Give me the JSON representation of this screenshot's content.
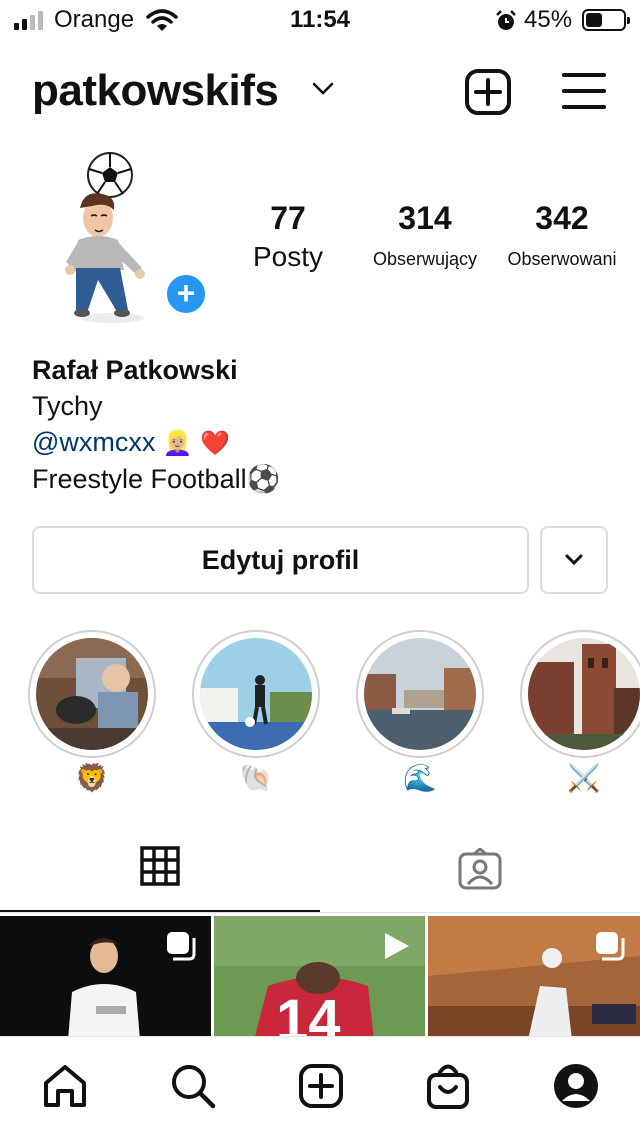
{
  "status": {
    "carrier": "Orange",
    "time": "11:54",
    "battery_percent": "45%",
    "battery_level": 0.45,
    "icons": [
      "signal-icon",
      "wifi-icon",
      "alarm-icon",
      "battery-icon"
    ]
  },
  "header": {
    "username": "patkowskifs",
    "icons": [
      "chevron-down-icon",
      "new-post-icon",
      "menu-icon"
    ]
  },
  "stats": [
    {
      "value": "77",
      "label": "Posty"
    },
    {
      "value": "314",
      "label": "Obserwujący"
    },
    {
      "value": "342",
      "label": "Obserwowani"
    }
  ],
  "bio": {
    "name": "Rafał Patkowski",
    "city": "Tychy",
    "mention": "@wxmcxx",
    "mention_emoji": "👱🏼‍♀️ ❤️",
    "description": "Freestyle Football⚽"
  },
  "actions": {
    "edit_profile": "Edytuj profil"
  },
  "highlights": [
    {
      "emoji": "🦁"
    },
    {
      "emoji": "🐚"
    },
    {
      "emoji": "🌊"
    },
    {
      "emoji": "⚔️"
    }
  ],
  "tabs": [
    "grid-icon",
    "tagged-icon"
  ],
  "nav": [
    "home-icon",
    "search-icon",
    "add-icon",
    "shop-icon",
    "profile-icon"
  ],
  "colors": {
    "link": "#00376b",
    "accent_blue": "#2696f3",
    "border": "#dbdbdb"
  }
}
